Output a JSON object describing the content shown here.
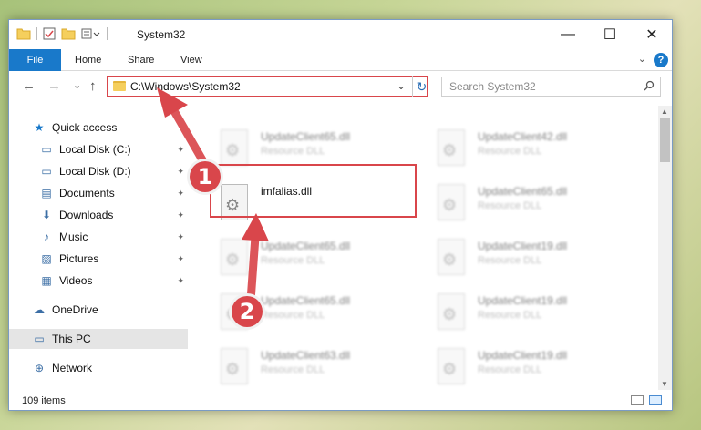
{
  "window": {
    "title": "System32",
    "minimize": "—",
    "maximize": "☐",
    "close": "✕"
  },
  "ribbon": {
    "tabs": [
      "File",
      "Home",
      "Share",
      "View"
    ],
    "help": "?"
  },
  "nav": {
    "back": "←",
    "forward": "→",
    "recent": "⌄",
    "up": "↑",
    "address": "C:\\Windows\\System32",
    "refresh": "↻",
    "search_placeholder": "Search System32",
    "search_icon": "⚲"
  },
  "sidebar": {
    "items": [
      {
        "label": "Quick access",
        "icon": "star-icon",
        "glyph": "★",
        "color": "#1979ca"
      },
      {
        "label": "Local Disk (C:)",
        "icon": "drive-icon",
        "glyph": "▭",
        "pinned": true
      },
      {
        "label": "Local Disk (D:)",
        "icon": "drive-icon",
        "glyph": "▭",
        "pinned": true
      },
      {
        "label": "Documents",
        "icon": "documents-icon",
        "glyph": "▤",
        "pinned": true
      },
      {
        "label": "Downloads",
        "icon": "downloads-icon",
        "glyph": "⬇",
        "pinned": true
      },
      {
        "label": "Music",
        "icon": "music-icon",
        "glyph": "♪",
        "pinned": true
      },
      {
        "label": "Pictures",
        "icon": "pictures-icon",
        "glyph": "▨",
        "pinned": true
      },
      {
        "label": "Videos",
        "icon": "videos-icon",
        "glyph": "▦",
        "pinned": true
      },
      {
        "label": "OneDrive",
        "icon": "cloud-icon",
        "glyph": "☁"
      },
      {
        "label": "This PC",
        "icon": "computer-icon",
        "glyph": "▭",
        "selected": true
      },
      {
        "label": "Network",
        "icon": "network-icon",
        "glyph": "⊕"
      }
    ],
    "pin_glyph": "📌"
  },
  "files": [
    {
      "name": "UpdateClient65.dll",
      "type": "Resource DLL",
      "blurred": true
    },
    {
      "name": "UpdateClient42.dll",
      "type": "Resource DLL",
      "blurred": true
    },
    {
      "name": "imfalias.dll",
      "type": "",
      "blurred": false
    },
    {
      "name": "UpdateClient65.dll",
      "type": "Resource DLL",
      "blurred": true
    },
    {
      "name": "UpdateClient65.dll",
      "type": "Resource DLL",
      "blurred": true
    },
    {
      "name": "UpdateClient19.dll",
      "type": "Resource DLL",
      "blurred": true
    },
    {
      "name": "UpdateClient65.dll",
      "type": "Resource DLL",
      "blurred": true
    },
    {
      "name": "UpdateClient19.dll",
      "type": "Resource DLL",
      "blurred": true
    },
    {
      "name": "UpdateClient63.dll",
      "type": "Resource DLL",
      "blurred": true
    },
    {
      "name": "UpdateClient19.dll",
      "type": "Resource DLL",
      "blurred": true
    }
  ],
  "status": {
    "item_count": "109 items"
  },
  "annotations": {
    "step1": "1",
    "step2": "2",
    "color": "#d9464b"
  }
}
